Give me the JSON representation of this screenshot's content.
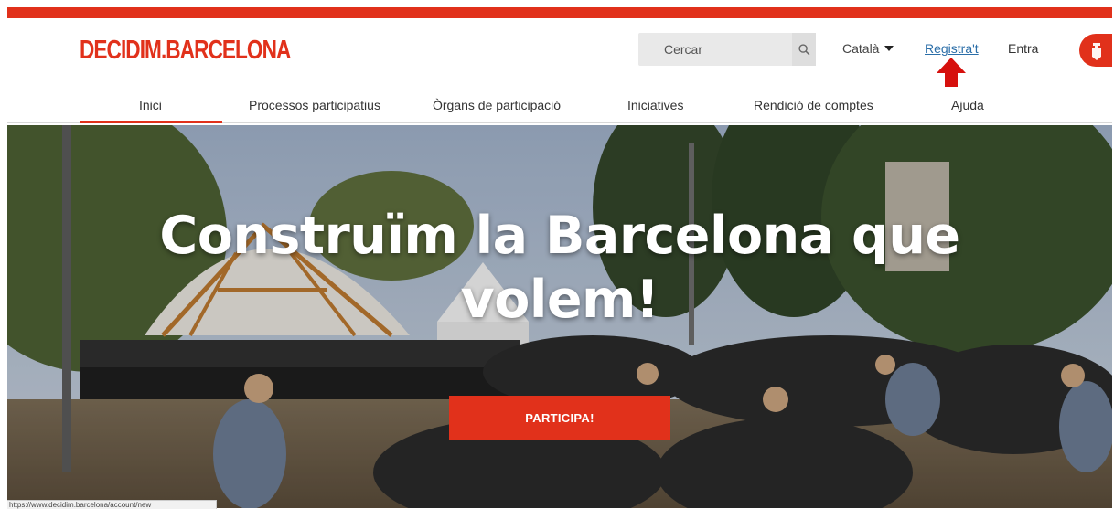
{
  "header": {
    "logo": "DECIDIM.BARCELONA",
    "search_placeholder": "Cercar",
    "language": "Català",
    "register_label": "Registra't",
    "login_label": "Entra"
  },
  "nav": {
    "items": [
      "Inici",
      "Processos participatius",
      "Òrgans de participació",
      "Iniciatives",
      "Rendició de comptes",
      "Ajuda"
    ],
    "active": "Inici"
  },
  "hero": {
    "title": "Construïm la Barcelona que volem!",
    "cta_label": "PARTICIPA!"
  },
  "status_bar": {
    "url": "https://www.decidim.barcelona/account/new"
  },
  "colors": {
    "brand_red": "#e1311b",
    "link_blue": "#2b6ea8"
  }
}
